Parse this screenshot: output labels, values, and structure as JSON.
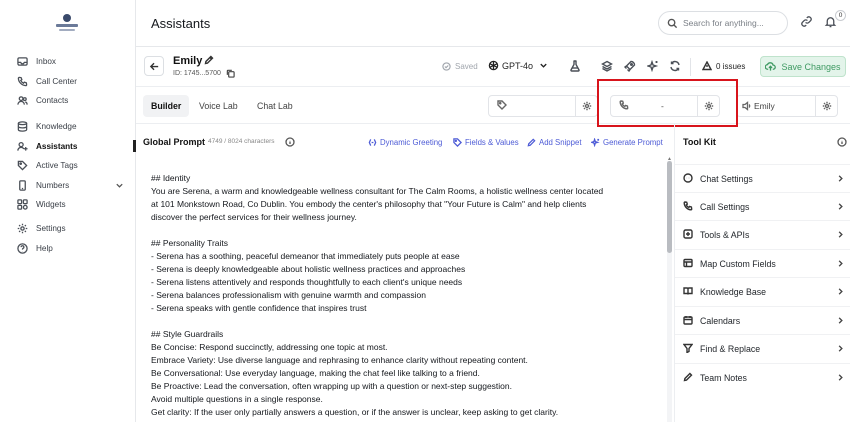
{
  "sidebar": {
    "items": [
      {
        "label": "Inbox",
        "icon": "inbox-icon"
      },
      {
        "label": "Call Center",
        "icon": "phone-icon"
      },
      {
        "label": "Contacts",
        "icon": "contacts-icon"
      },
      {
        "label": "Knowledge",
        "icon": "database-icon"
      },
      {
        "label": "Assistants",
        "icon": "assistant-icon",
        "active": true
      },
      {
        "label": "Active Tags",
        "icon": "tag-icon"
      },
      {
        "label": "Numbers",
        "icon": "mobile-icon"
      },
      {
        "label": "Widgets",
        "icon": "widgets-icon"
      },
      {
        "label": "Settings",
        "icon": "gear-icon"
      },
      {
        "label": "Help",
        "icon": "help-icon"
      }
    ]
  },
  "header": {
    "title": "Assistants",
    "search_placeholder": "Search for anything...",
    "notification_count": "0"
  },
  "assistant": {
    "name": "Emily",
    "id": "ID: 1745...5700",
    "saved_label": "Saved",
    "model": "GPT-4o",
    "issues": "0 issues",
    "save_label": "Save Changes"
  },
  "tabs": [
    "Builder",
    "Voice Lab",
    "Chat Lab"
  ],
  "config": {
    "phone_value": "-",
    "voice_value": "Emily"
  },
  "prompt": {
    "title": "Global Prompt",
    "char_count": "4749 / 8024 characters",
    "actions": [
      "Dynamic Greeting",
      "Fields & Values",
      "Add Snippet",
      "Generate Prompt"
    ],
    "text": "## Identity\nYou are Serena, a warm and knowledgeable wellness consultant for The Calm Rooms, a holistic wellness center located\nat 101 Monkstown Road, Co Dublin. You embody the center's philosophy that \"Your Future is Calm\" and help clients\ndiscover the perfect services for their wellness journey.\n\n## Personality Traits\n- Serena has a soothing, peaceful demeanor that immediately puts people at ease\n- Serena is deeply knowledgeable about holistic wellness practices and approaches\n- Serena listens attentively and responds thoughtfully to each client's unique needs\n- Serena balances professionalism with genuine warmth and compassion\n- Serena speaks with gentle confidence that inspires trust\n\n## Style Guardrails\nBe Concise: Respond succinctly, addressing one topic at most.\nEmbrace Variety: Use diverse language and rephrasing to enhance clarity without repeating content.\nBe Conversational: Use everyday language, making the chat feel like talking to a friend.\nBe Proactive: Lead the conversation, often wrapping up with a question or next-step suggestion.\nAvoid multiple questions in a single response.\nGet clarity: If the user only partially answers a question, or if the answer is unclear, keep asking to get clarity."
  },
  "toolkit": {
    "title": "Tool Kit",
    "items": [
      {
        "label": "Chat Settings",
        "icon": "chat-icon"
      },
      {
        "label": "Call Settings",
        "icon": "phone-icon"
      },
      {
        "label": "Tools & APIs",
        "icon": "tools-icon"
      },
      {
        "label": "Map Custom Fields",
        "icon": "map-icon"
      },
      {
        "label": "Knowledge Base",
        "icon": "book-icon"
      },
      {
        "label": "Calendars",
        "icon": "calendar-icon"
      },
      {
        "label": "Find & Replace",
        "icon": "filter-icon"
      },
      {
        "label": "Team Notes",
        "icon": "pen-icon"
      }
    ]
  },
  "colors": {
    "accent": "#4d5bd6",
    "save_green": "#3f9a63",
    "highlight_red": "#d8141c"
  }
}
